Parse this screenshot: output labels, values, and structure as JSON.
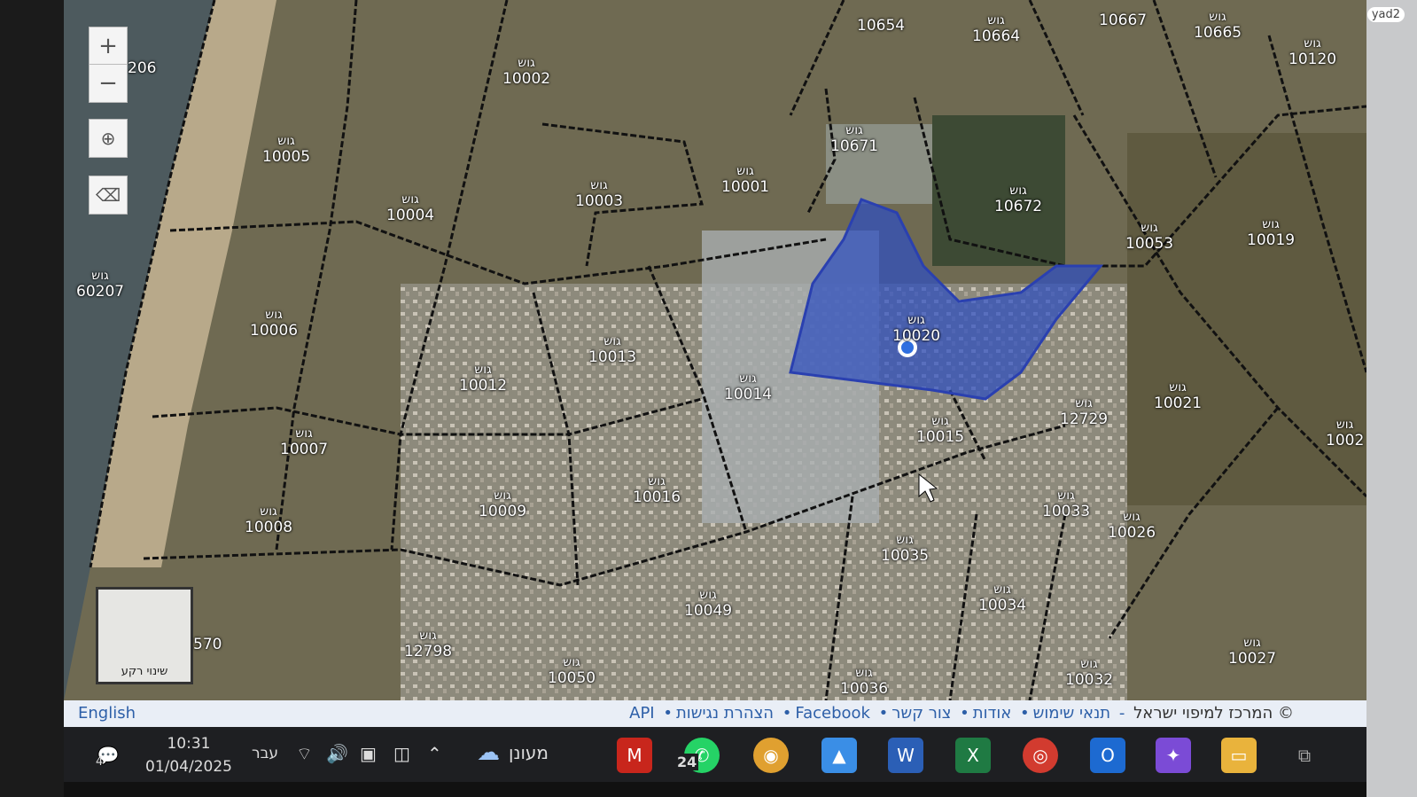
{
  "watermark": "yad2",
  "map": {
    "zoom_in": "+",
    "zoom_out": "−",
    "basemap_label": "שינוי רקע",
    "edge_label": "570",
    "parcels": [
      {
        "k": "גוש",
        "n": "10002"
      },
      {
        "k": "גוש",
        "n": "10003"
      },
      {
        "k": "גוש",
        "n": "10001"
      },
      {
        "k": "גוש",
        "n": "10671"
      },
      {
        "k": "גוש",
        "n": "10664"
      },
      {
        "k": "גוש",
        "n": "10665"
      },
      {
        "k": "גוש",
        "n": "10120"
      },
      {
        "k": "",
        "n": "10667"
      },
      {
        "k": "",
        "n": "10654"
      },
      {
        "k": "גוש",
        "n": "10005"
      },
      {
        "k": "גוש",
        "n": "10004"
      },
      {
        "k": "גוש",
        "n": "60207"
      },
      {
        "k": "גוש",
        "n": "10672"
      },
      {
        "k": "גוש",
        "n": "10053"
      },
      {
        "k": "גוש",
        "n": "10019"
      },
      {
        "k": "גוש",
        "n": "10006"
      },
      {
        "k": "גוש",
        "n": "10013"
      },
      {
        "k": "גוש",
        "n": "10012"
      },
      {
        "k": "גוש",
        "n": "10014"
      },
      {
        "k": "גוש",
        "n": "10020"
      },
      {
        "k": "גוש",
        "n": "10021"
      },
      {
        "k": "גוש",
        "n": "12729"
      },
      {
        "k": "גוש",
        "n": "10015"
      },
      {
        "k": "גוש",
        "n": "10007"
      },
      {
        "k": "גוש",
        "n": "10016"
      },
      {
        "k": "גוש",
        "n": "10009"
      },
      {
        "k": "גוש",
        "n": "10008"
      },
      {
        "k": "גוש",
        "n": "10033"
      },
      {
        "k": "גוש",
        "n": "10026"
      },
      {
        "k": "גוש",
        "n": "10035"
      },
      {
        "k": "גוש",
        "n": "10034"
      },
      {
        "k": "גוש",
        "n": "10049"
      },
      {
        "k": "גוש",
        "n": "12798"
      },
      {
        "k": "גוש",
        "n": "10050"
      },
      {
        "k": "גוש",
        "n": "10036"
      },
      {
        "k": "גוש",
        "n": "10032"
      },
      {
        "k": "גוש",
        "n": "10027"
      },
      {
        "k": "גוש",
        "n": "1002"
      },
      {
        "k": "",
        "n": "206"
      }
    ]
  },
  "footer": {
    "language": "English",
    "copyright": "© המרכז למיפוי ישראל",
    "links": [
      "תנאי שימוש",
      "אודות",
      "צור קשר",
      "Facebook",
      "הצהרת נגישות",
      "API"
    ]
  },
  "taskbar": {
    "time": "10:31",
    "date": "01/04/2025",
    "lang": "עבר",
    "weather": "מעונן",
    "notif_count": "4",
    "whatsapp_badge": "24"
  }
}
